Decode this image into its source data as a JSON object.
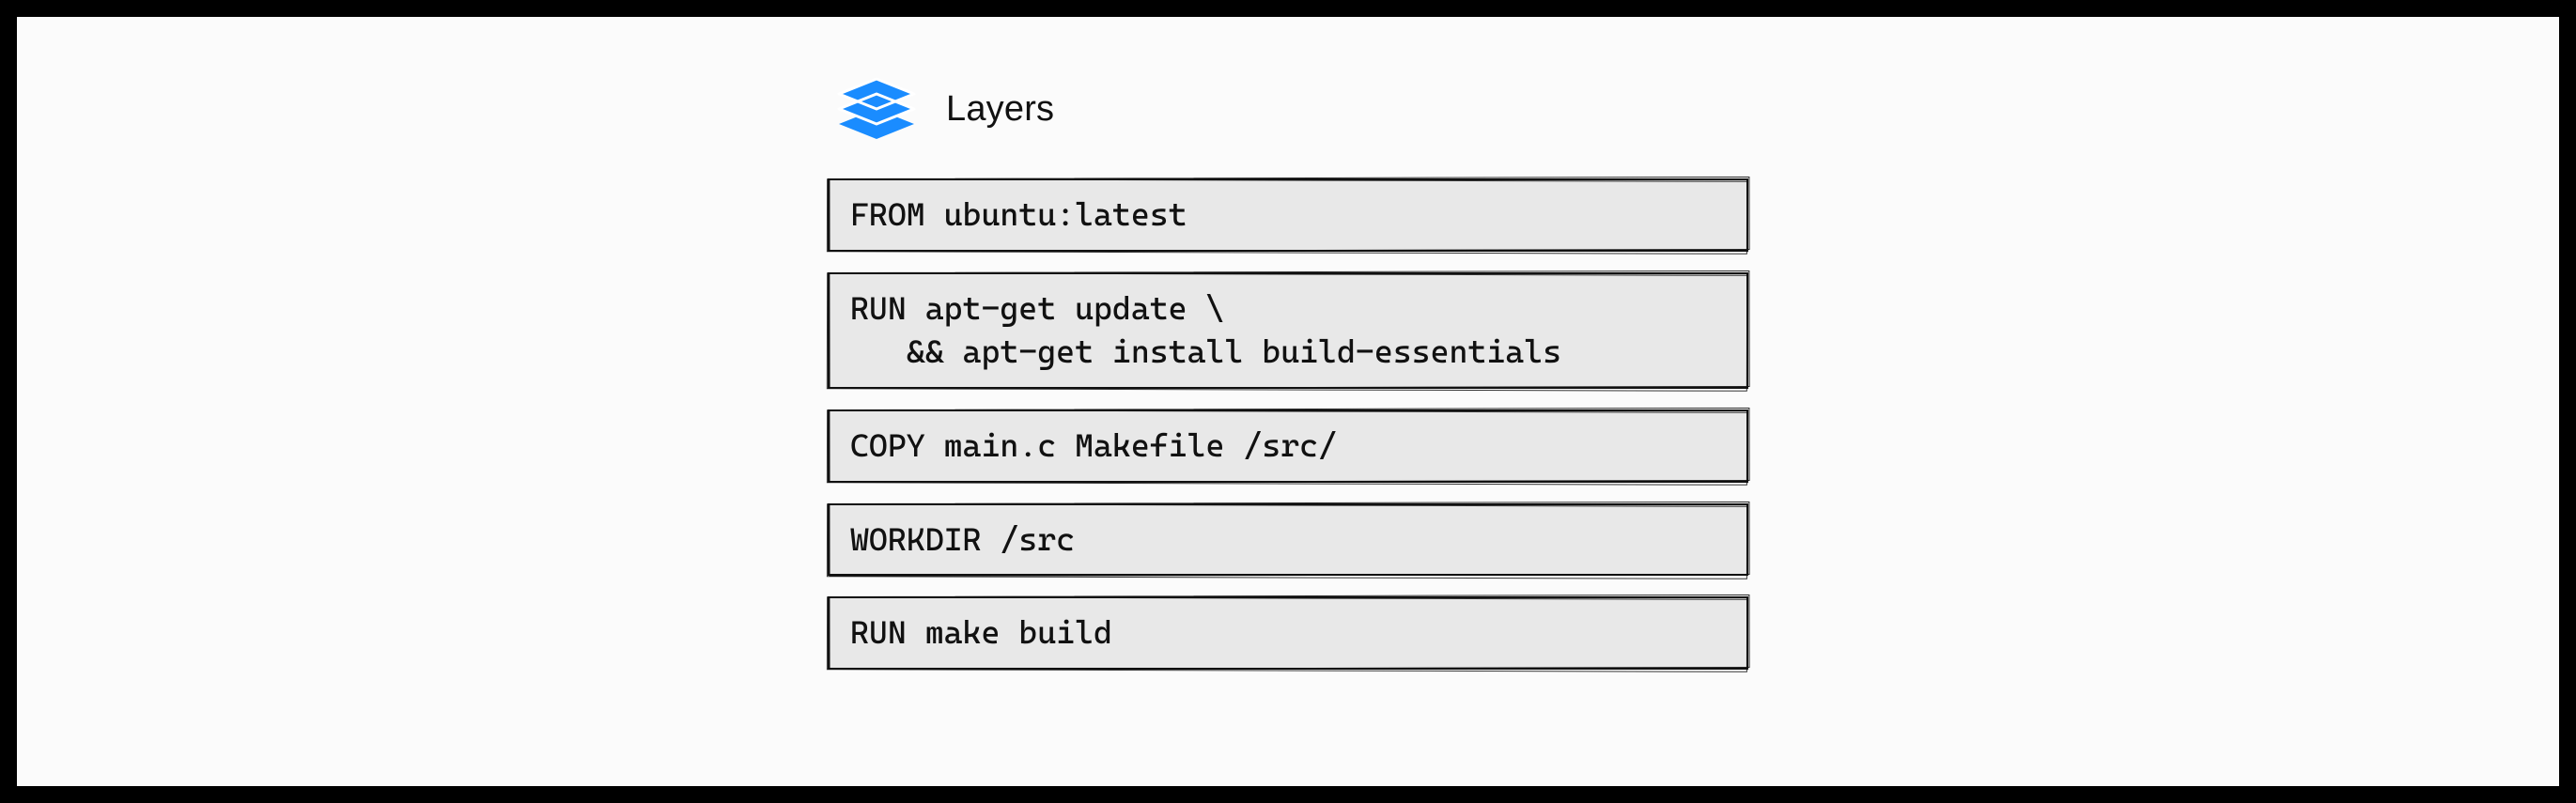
{
  "title": "Layers",
  "icon_color": "#1a8cff",
  "layers": [
    "FROM ubuntu:latest",
    "RUN apt-get update \\\n   && apt-get install build-essentials",
    "COPY main.c Makefile /src/",
    "WORKDIR /src",
    "RUN make build"
  ]
}
